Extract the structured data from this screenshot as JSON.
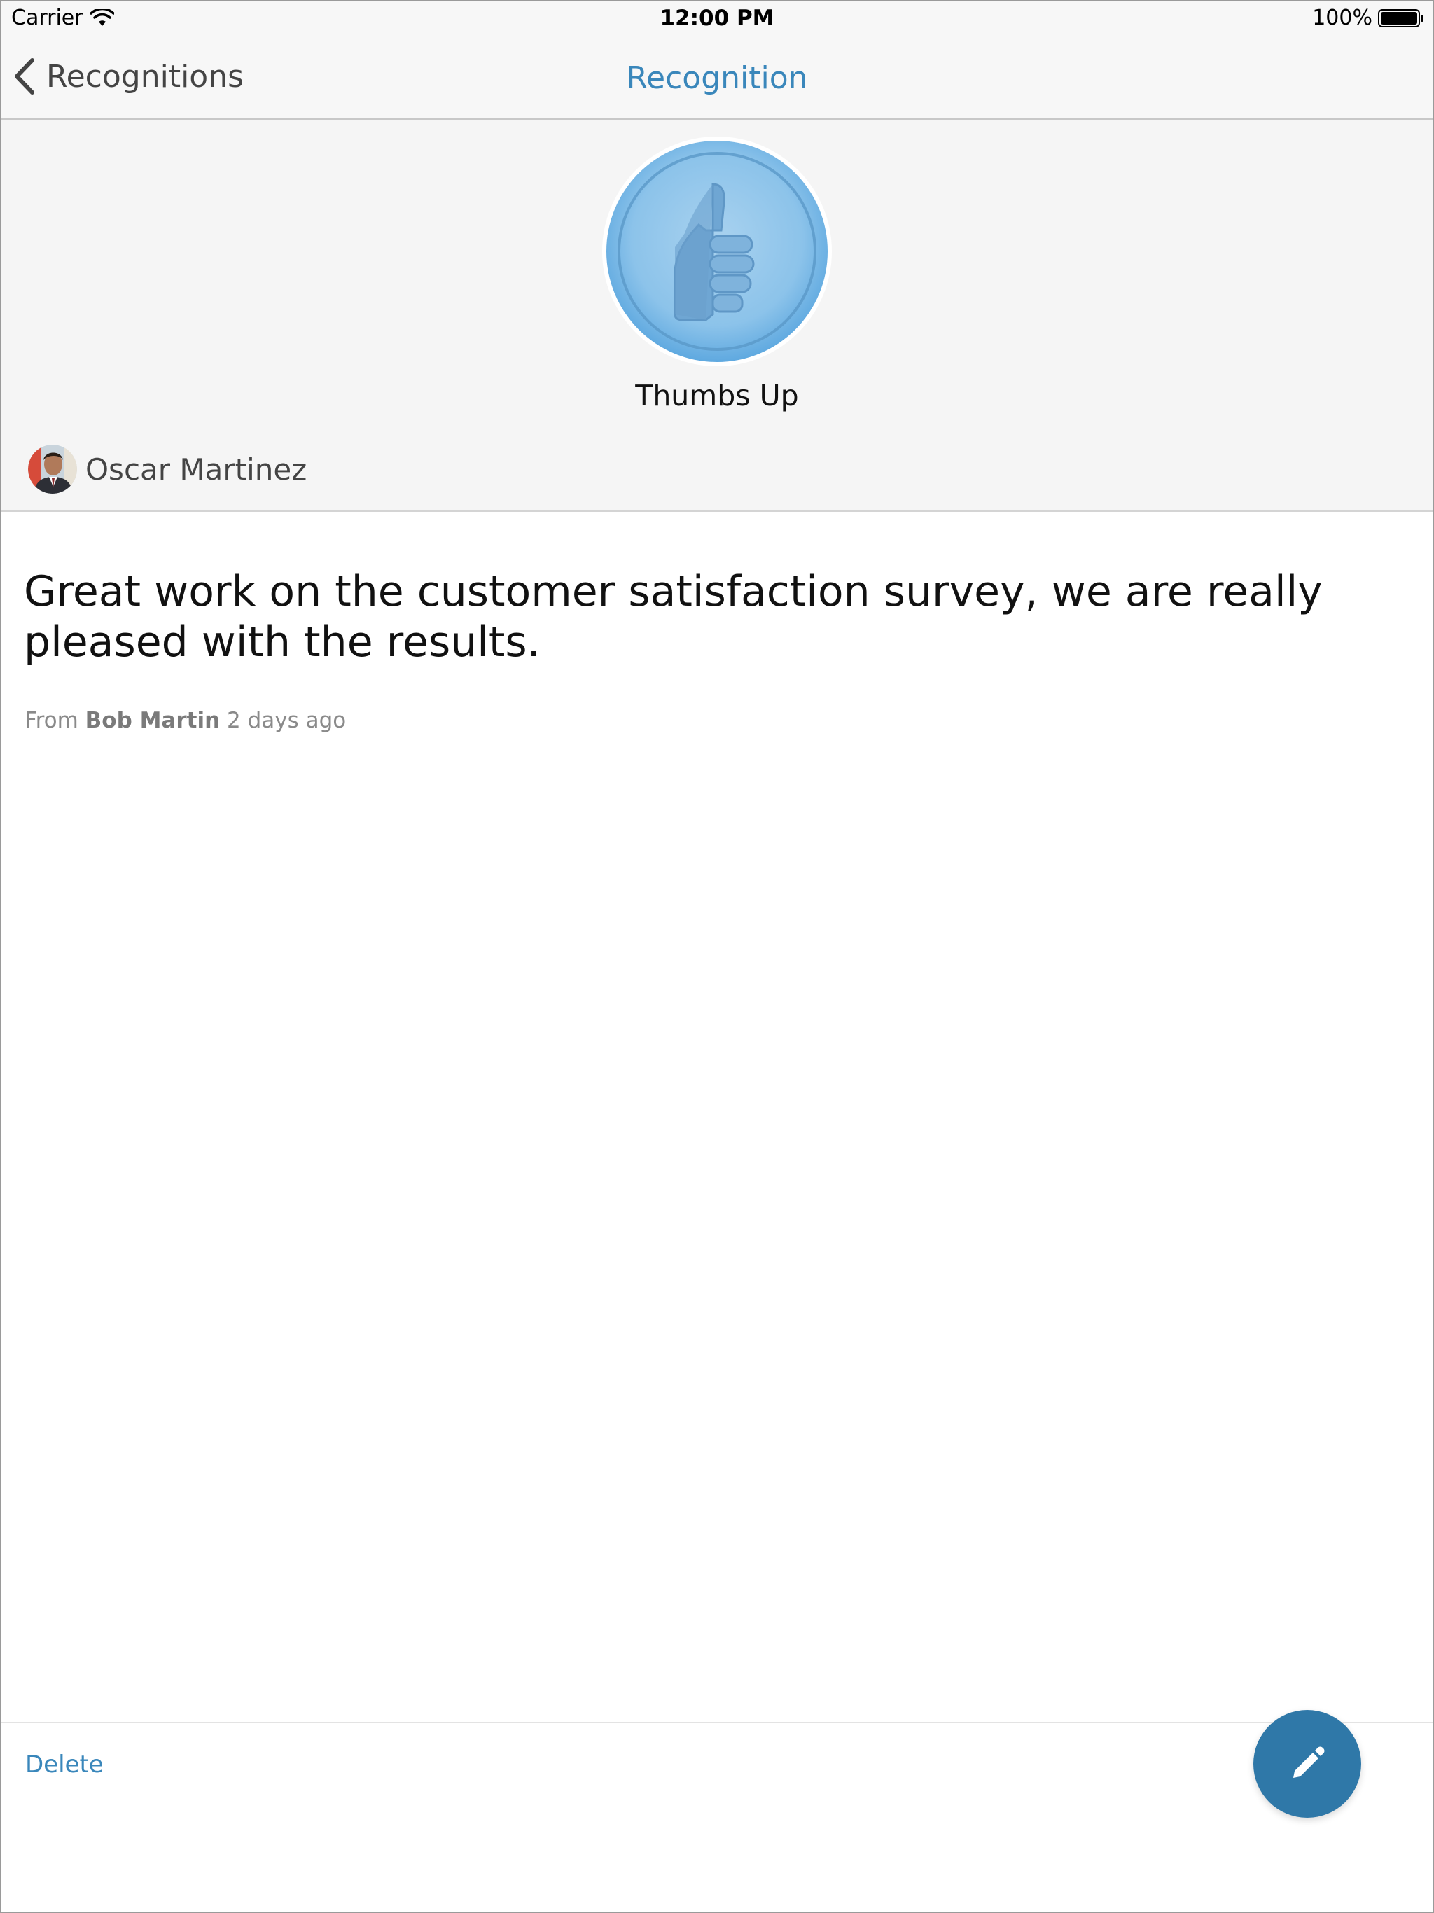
{
  "status_bar": {
    "carrier": "Carrier",
    "time": "12:00 PM",
    "battery": "100%",
    "wifi_icon": "wifi-icon",
    "battery_icon": "battery-icon"
  },
  "nav": {
    "back_label": "Recognitions",
    "back_icon": "chevron-left-icon",
    "title": "Recognition"
  },
  "badge": {
    "name": "Thumbs Up",
    "icon": "thumbs-up-icon"
  },
  "recipient": {
    "name": "Oscar Martinez"
  },
  "message": {
    "text": "Great work on the customer satisfaction survey, we are really pleased with the results.",
    "from_prefix": "From",
    "sender": "Bob Martin",
    "time_ago": "2 days ago"
  },
  "actions": {
    "delete_label": "Delete",
    "edit_icon": "pencil-icon"
  },
  "colors": {
    "accent": "#3a87bb",
    "fab": "#2f78a8",
    "header_bg": "#f5f5f5"
  }
}
